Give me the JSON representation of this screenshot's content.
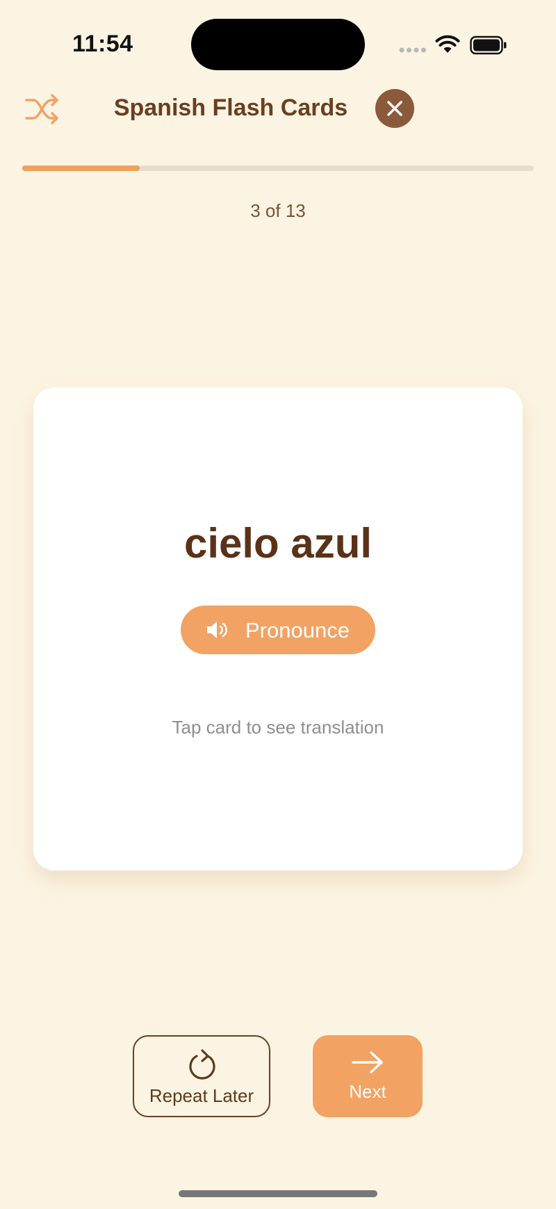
{
  "status_bar": {
    "time": "11:54"
  },
  "header": {
    "title": "Spanish Flash Cards",
    "shuffle_icon": "shuffle-icon",
    "close_icon": "close-icon"
  },
  "progress": {
    "current": 3,
    "total": 13,
    "fraction": 0.23,
    "label": "3 of 13"
  },
  "card": {
    "word": "cielo azul",
    "pronounce_label": "Pronounce",
    "pronounce_icon": "speaker-icon",
    "hint": "Tap card to see translation"
  },
  "actions": {
    "repeat_label": "Repeat Later",
    "repeat_icon": "refresh-icon",
    "next_label": "Next",
    "next_icon": "arrow-right-icon"
  },
  "colors": {
    "background": "#FCF4E2",
    "accent": "#F2A262",
    "brown": "#6B3E20",
    "close_bg": "#8A5A3A"
  }
}
